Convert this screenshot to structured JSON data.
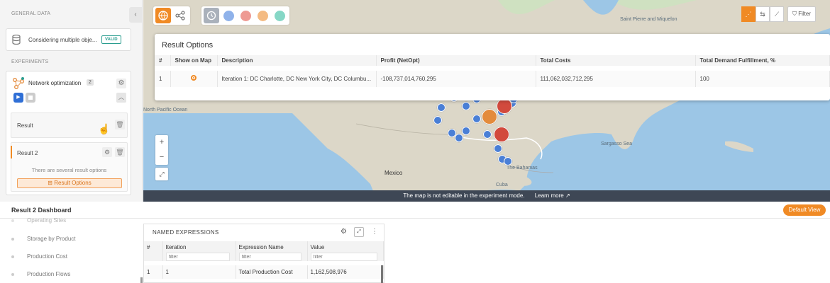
{
  "left_panel": {
    "general_data_title": "GENERAL DATA",
    "collapse_icon": "chevron-left-icon",
    "general_card": {
      "text": "Considering multiple obje...",
      "badge": "VALID"
    },
    "experiments_title": "EXPERIMENTS",
    "experiment": {
      "name": "Network optimization",
      "count": "2",
      "results": [
        {
          "label": "Result"
        },
        {
          "label": "Result 2",
          "note": "There are several result options",
          "button": "Result Options"
        }
      ]
    }
  },
  "map": {
    "toolbar_left": [
      "globe-icon",
      "network-graph-icon"
    ],
    "toolbar_mid": [
      "clock-icon",
      "customer-icon",
      "factory-icon",
      "warehouse-icon",
      "add-icon"
    ],
    "filter_label": "Filter",
    "labels": {
      "mexico": "Mexico",
      "cuba": "Cuba",
      "bahamas": "The Bahamas",
      "sargasso": "Sargasso Sea",
      "saint_pierre": "Saint Pierre and Miquelon",
      "north_pacific": "North Pacific Ocean"
    },
    "banner_text": "The map is not editable in the experiment mode.",
    "banner_link": "Learn more",
    "colors": {
      "accent": "#f08a24",
      "customer": "#4a7fd6",
      "dc": "#e38b3c",
      "factory": "#d24a3d"
    }
  },
  "result_options": {
    "title": "Result Options",
    "columns": [
      "#",
      "Show on Map",
      "Description",
      "Profit (NetOpt)",
      "Total Costs",
      "Total Demand Fulfillment, %"
    ],
    "rows": [
      {
        "num": "1",
        "description": "Iteration 1: DC Charlotte, DC New York City, DC Columbu...",
        "profit": "-108,737,014,760,295",
        "total_costs": "111,062,032,712,295",
        "demand": "100"
      }
    ]
  },
  "dashboard": {
    "title": "Result 2 Dashboard",
    "default_view": "Default View",
    "nav": [
      "Operating Sites",
      "Storage by Product",
      "Production Cost",
      "Production Flows"
    ],
    "named_expressions": {
      "title": "NAMED EXPRESSIONS",
      "columns": [
        "#",
        "Iteration",
        "Expression Name",
        "Value"
      ],
      "filter_placeholder": "filter",
      "rows": [
        {
          "num": "1",
          "iteration": "1",
          "name": "Total Production Cost",
          "value": "1,162,508,976"
        }
      ]
    }
  }
}
